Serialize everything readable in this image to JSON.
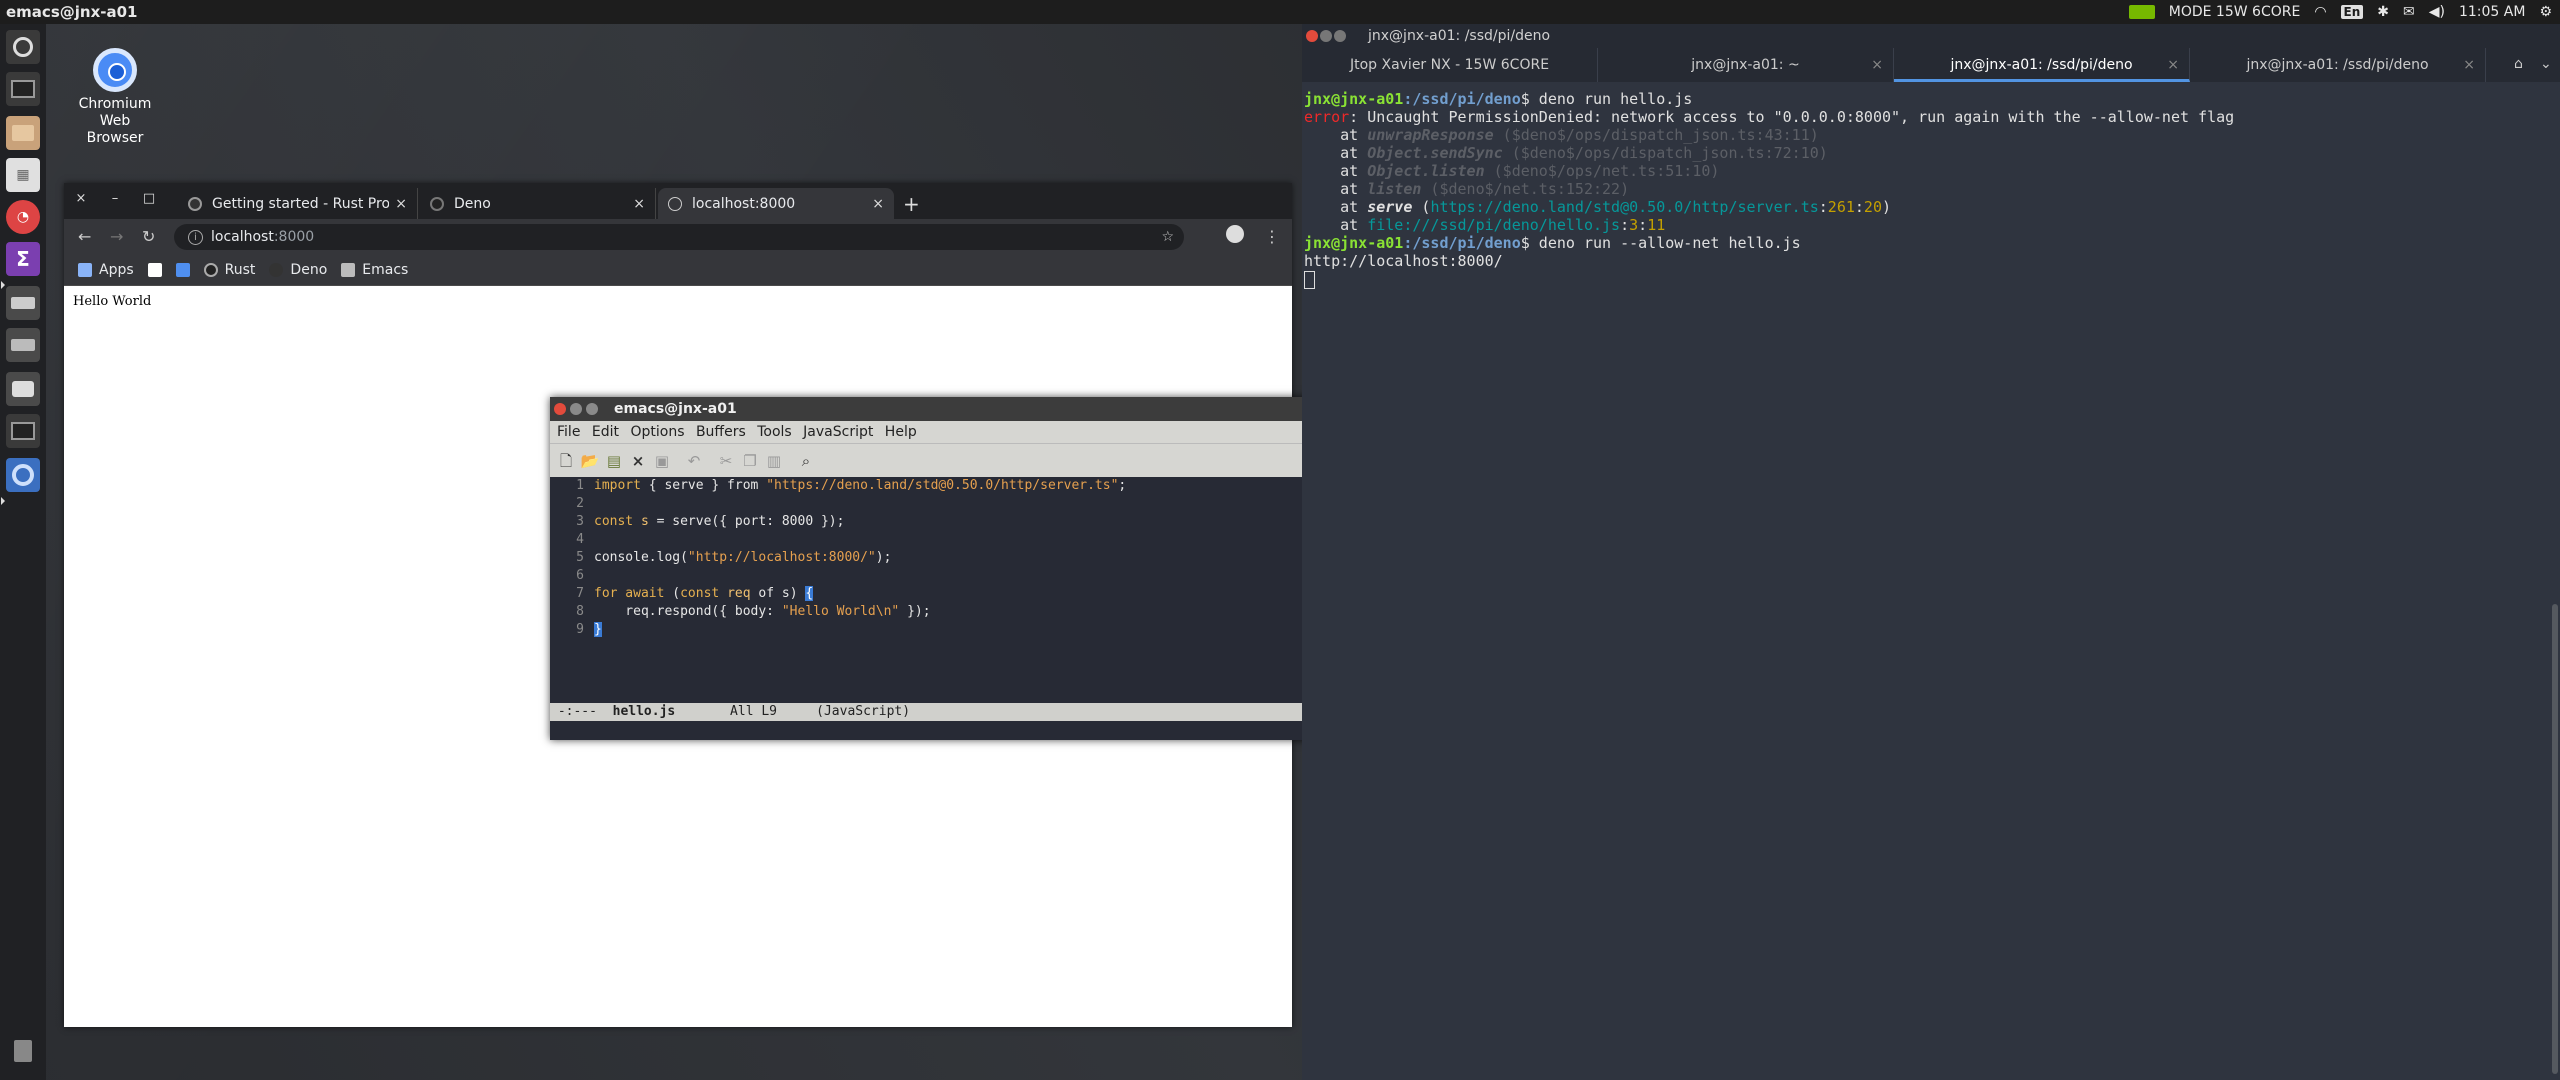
{
  "top_panel": {
    "title": "emacs@jnx-a01",
    "mode": "MODE 15W 6CORE",
    "keyboard": "En",
    "time": "11:05 AM"
  },
  "desktop": {
    "icons": [
      {
        "label": "Chromium Web Browser",
        "icon": "chromium-icon"
      }
    ]
  },
  "launcher": {
    "items": [
      "ubuntu-icon",
      "terminal-icon",
      "files-icon",
      "software-icon",
      "speedometer-icon",
      "emacs-icon",
      "drive-icon",
      "drive2-icon",
      "camera-icon",
      "terminal2-icon",
      "chromium-icon",
      "trash-icon"
    ]
  },
  "chrome": {
    "tabs": [
      {
        "label": "Getting started - Rust Pro",
        "icon": "rust-icon"
      },
      {
        "label": "Deno",
        "icon": "deno-icon"
      },
      {
        "label": "localhost:8000",
        "icon": "globe-icon",
        "active": true
      }
    ],
    "url_host": "localhost",
    "url_port": ":8000",
    "bookmarks": [
      {
        "label": "Apps",
        "icon": "apps-icon"
      },
      {
        "label": "",
        "icon": "github-icon"
      },
      {
        "label": "",
        "icon": "doc-icon"
      },
      {
        "label": "Rust",
        "icon": "rust-icon"
      },
      {
        "label": "Deno",
        "icon": "deno-icon"
      },
      {
        "label": "Emacs",
        "icon": "folder-icon"
      }
    ],
    "page_text": "Hello World"
  },
  "emacs": {
    "title": "emacs@jnx-a01",
    "menu": [
      "File",
      "Edit",
      "Options",
      "Buffers",
      "Tools",
      "JavaScript",
      "Help"
    ],
    "line_numbers": [
      "1",
      "2",
      "3",
      "4",
      "5",
      "6",
      "7",
      "8",
      "9"
    ],
    "code": {
      "l1_kw": "import",
      "l1_mid": " { serve } from ",
      "l1_str": "\"https://deno.land/std@0.50.0/http/server.ts\"",
      "l1_end": ";",
      "l3_kw": "const",
      "l3_var": " s",
      "l3_rest": " = serve({ port: 8000 });",
      "l5_a": "console.log(",
      "l5_str": "\"http://localhost:8000/\"",
      "l5_end": ");",
      "l7_kw1": "for",
      "l7_kw2": " await",
      "l7_a": " (",
      "l7_kw3": "const",
      "l7_var": " req",
      "l7_b": " of s) ",
      "l7_brace": "{",
      "l8_a": "    req.respond({ body: ",
      "l8_str": "\"Hello World\\n\"",
      "l8_end": " });",
      "l9_brace": "}"
    },
    "modeline": {
      "status": " -:---  ",
      "buffer": "hello.js",
      "position": "       All L9     ",
      "mode": "(JavaScript)"
    }
  },
  "terminal": {
    "title": "jnx@jnx-a01: /ssd/pi/deno",
    "tabs": [
      {
        "label": "Jtop Xavier NX - 15W 6CORE"
      },
      {
        "label": "jnx@jnx-a01: ~"
      },
      {
        "label": "jnx@jnx-a01: /ssd/pi/deno",
        "active": true
      },
      {
        "label": "jnx@jnx-a01: /ssd/pi/deno"
      }
    ],
    "prompt_user": "jnx@jnx-a01",
    "prompt_path": ":/ssd/pi/deno",
    "prompt_dollar": "$",
    "cmd1": " deno run hello.js",
    "error_label": "error",
    "error_msg": ": Uncaught PermissionDenied: network access to \"0.0.0.0:8000\", run again with the --allow-net flag",
    "at": "    at ",
    "st1_fn": "unwrapResponse",
    "st1_loc": " ($deno$/ops/dispatch_json.ts:43:11)",
    "st2_fn": "Object.sendSync",
    "st2_loc": " ($deno$/ops/dispatch_json.ts:72:10)",
    "st3_fn": "Object.listen",
    "st3_loc": " ($deno$/ops/net.ts:51:10)",
    "st4_fn": "listen",
    "st4_loc": " ($deno$/net.ts:152:22)",
    "st5_fn": "serve",
    "st5_open": " (",
    "st5_url": "https://deno.land/std@0.50.0/http/server.ts",
    "st5_c1": ":",
    "st5_line": "261",
    "st5_c2": ":",
    "st5_col": "20",
    "st5_close": ")",
    "st6_url": "file:///ssd/pi/deno/hello.js",
    "st6_c1": ":",
    "st6_line": "3",
    "st6_c2": ":",
    "st6_col": "11",
    "cmd2": " deno run --allow-net hello.js",
    "output": "http://localhost:8000/"
  }
}
